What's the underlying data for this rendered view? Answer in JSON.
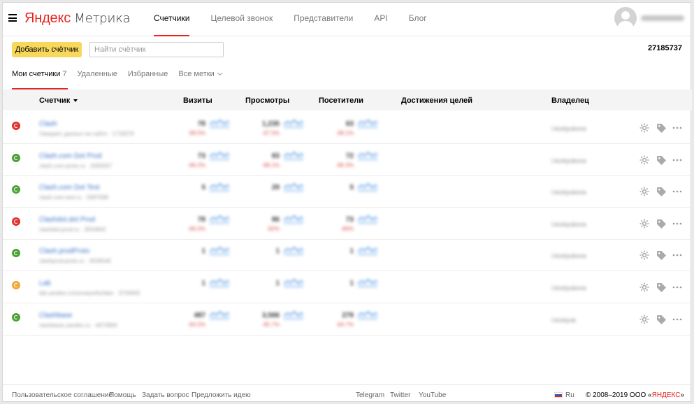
{
  "header": {
    "logo_brand": "Яндекс",
    "logo_product": "Метрика",
    "nav": [
      "Счетчики",
      "Целевой звонок",
      "Представители",
      "API",
      "Блог"
    ],
    "active_nav": 0,
    "username": "l.kostyukova"
  },
  "toolbar": {
    "add_label": "Добавить счётчик",
    "search_placeholder": "Найти счётчик",
    "counter_id": "27185737"
  },
  "tabs": {
    "mine": "Мои счетчики",
    "mine_count": "7",
    "deleted": "Удаленные",
    "favorites": "Избранные",
    "all_tags": "Все метки"
  },
  "table": {
    "headers": {
      "counter": "Счетчик",
      "visits": "Визиты",
      "views": "Просмотры",
      "visitors": "Посетители",
      "goals": "Достижения целей",
      "owner": "Владелец"
    },
    "rows": [
      {
        "status": "error",
        "name": "Clash",
        "sub": "Ожидает данных на сайте · 1718379",
        "visits": "78",
        "visits_delta": "-98.5%",
        "views": "1,235",
        "views_delta": "-97.5%",
        "visitors": "63",
        "visitors_delta": "-98.1%",
        "owner": "l.kostyukova"
      },
      {
        "status": "ok",
        "name": "Clash.com Dot Prod",
        "sub": "clash.com.proto.ru · 2083567",
        "visits": "73",
        "visits_delta": "-86.2%",
        "views": "83",
        "views_delta": "-88.1%",
        "visitors": "72",
        "visitors_delta": "-86.3%",
        "owner": "l.kostyukova"
      },
      {
        "status": "ok",
        "name": "Clash.com Dot Test",
        "sub": "clash.com.test.ru · 2087698",
        "visits": "5",
        "visits_delta": "",
        "views": "29",
        "views_delta": "",
        "visitors": "5",
        "visitors_delta": "",
        "owner": "l.kostyukova"
      },
      {
        "status": "error",
        "name": "Clashdot.dot Prod",
        "sub": "clashdot.prod.ru · 3554842",
        "visits": "78",
        "visits_delta": "-86.0%",
        "views": "86",
        "views_delta": "-82%",
        "visitors": "73",
        "visitors_delta": "-86%",
        "owner": "l.kostyukova"
      },
      {
        "status": "ok",
        "name": "Clash.prodProto",
        "sub": "clashprod.proto.ru · 3558546",
        "visits": "1",
        "visits_delta": "",
        "views": "1",
        "views_delta": "",
        "visitors": "1",
        "visitors_delta": "",
        "owner": "l.kostyukova"
      },
      {
        "status": "warn",
        "name": "Lab",
        "sub": "lab.yandex.ru/someprefix/labs · 3743665",
        "visits": "1",
        "visits_delta": "",
        "views": "1",
        "views_delta": "",
        "visitors": "1",
        "visitors_delta": "",
        "owner": "l.kostyukova"
      },
      {
        "status": "ok",
        "name": "Clashbase",
        "sub": "clashbase.yandex.ru · 4674983",
        "visits": "487",
        "visits_delta": "-84.5%",
        "views": "3,566",
        "views_delta": "-85.7%",
        "visitors": "279",
        "visitors_delta": "-84.7%",
        "owner": "l.kostyuk"
      }
    ]
  },
  "footer": {
    "links": [
      "Пользовательское соглашение",
      "Помощь",
      "Задать вопрос",
      "Предложить идею"
    ],
    "social": [
      "Telegram",
      "Twitter",
      "YouTube"
    ],
    "lang": "Ru",
    "copyright": "© 2008–2019 ООО «",
    "company": "ЯНДЕКС",
    "copyright_end": "»"
  },
  "colors": {
    "accent": "#e52620",
    "button": "#f7d85d",
    "status_ok": "#4ca236",
    "status_error": "#e0332f",
    "status_warn": "#f0a835"
  }
}
